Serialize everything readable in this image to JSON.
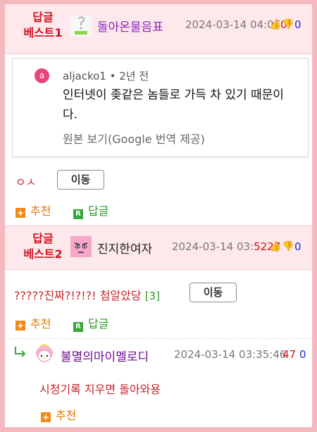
{
  "best1": {
    "label_line1": "답글",
    "label_line2": "베스트1",
    "nickname": "돌아온물음표",
    "nickname_color": "#8e1fbf",
    "date": "2024-03-14 04:0",
    "overlap": "60",
    "up_count": "",
    "down_count": "0",
    "avatar_caption": "물음표"
  },
  "quote_card": {
    "avatar_letter": "a",
    "meta": "aljacko1 • 2년 전",
    "text": "인터넷이 좆같은 놈들로 가득 차 있기 때문이다.",
    "translate_link": "원본 보기(Google 번역 제공)"
  },
  "best1_body": {
    "comment": "ㅇㅅ",
    "move_button": "이동",
    "recommend": "추천",
    "reply": "답글"
  },
  "best2": {
    "label_line1": "답글",
    "label_line2": "베스트2",
    "nickname": "진지한여자",
    "date": "2024-03-14 03:",
    "overlap": "5227",
    "up_count": "",
    "down_count": "0"
  },
  "best2_body": {
    "comment": "?????진짜?!?!?! 첨알았당",
    "reply_count": "[3]",
    "move_button": "이동",
    "recommend": "추천",
    "reply": "답글"
  },
  "sub_reply": {
    "nickname": "불멸의마이멜로디",
    "date": "2024-03-14 03:35:46",
    "up_count": "47",
    "down_count": "0",
    "comment": "시청기록 지우면 돌아와용",
    "recommend": "추천"
  }
}
